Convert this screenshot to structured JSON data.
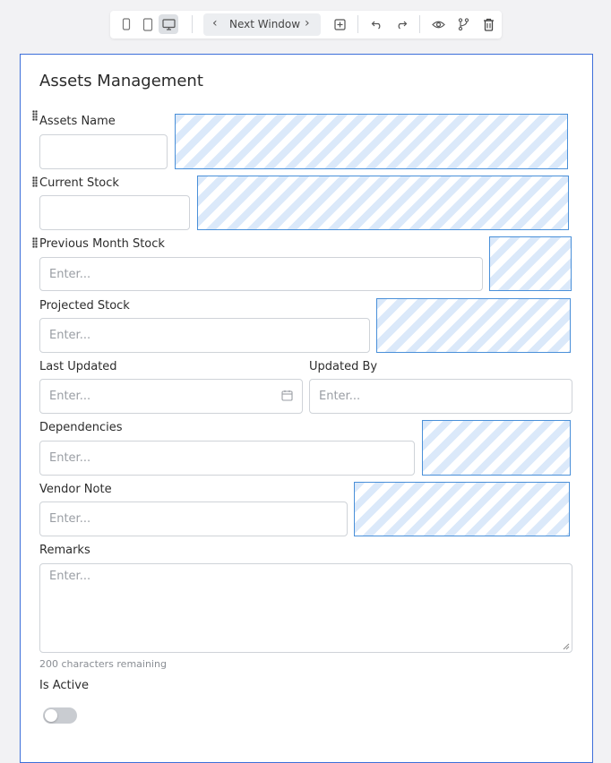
{
  "toolbar": {
    "nav_label": "Next Window",
    "icons": [
      "mobile-icon",
      "tablet-icon",
      "desktop-icon",
      "chevron-left-icon",
      "chevron-right-icon",
      "add-box-icon",
      "undo-icon",
      "redo-icon",
      "eye-icon",
      "branch-icon",
      "trash-icon"
    ],
    "active_view": "desktop"
  },
  "form": {
    "title": "Assets Management",
    "fields": {
      "assets_name": {
        "label": "Assets Name",
        "value": ""
      },
      "current_stock": {
        "label": "Current Stock",
        "value": ""
      },
      "previous_month_stock": {
        "label": "Previous Month Stock",
        "placeholder": "Enter..."
      },
      "projected_stock": {
        "label": "Projected Stock",
        "placeholder": "Enter..."
      },
      "last_updated": {
        "label": "Last Updated",
        "placeholder": "Enter..."
      },
      "updated_by": {
        "label": "Updated By",
        "placeholder": "Enter..."
      },
      "dependencies": {
        "label": "Dependencies",
        "placeholder": "Enter..."
      },
      "vendor_note": {
        "label": "Vendor Note",
        "placeholder": "Enter..."
      },
      "remarks": {
        "label": "Remarks",
        "placeholder": "Enter...",
        "helper": "200 characters remaining"
      },
      "is_active": {
        "label": "Is Active",
        "checked": false
      }
    }
  },
  "colors": {
    "canvas_border": "#3d6fd9",
    "placeholder_hatch": "#dbe9fa",
    "placeholder_border": "#4a90d9"
  }
}
